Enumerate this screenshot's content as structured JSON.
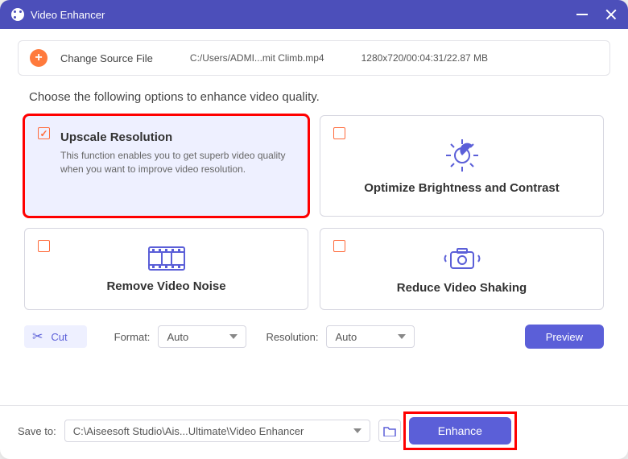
{
  "titlebar": {
    "title": "Video Enhancer"
  },
  "source": {
    "change_label": "Change Source File",
    "path": "C:/Users/ADMI...mit Climb.mp4",
    "info": "1280x720/00:04:31/22.87 MB"
  },
  "prompt": "Choose the following options to enhance video quality.",
  "options": {
    "upscale": {
      "title": "Upscale Resolution",
      "desc": "This function enables you to get superb video quality when you want to improve video resolution."
    },
    "brightness": {
      "title": "Optimize Brightness and Contrast"
    },
    "noise": {
      "title": "Remove Video Noise"
    },
    "shaking": {
      "title": "Reduce Video Shaking"
    }
  },
  "controls": {
    "cut": "Cut",
    "format_label": "Format:",
    "format_value": "Auto",
    "resolution_label": "Resolution:",
    "resolution_value": "Auto",
    "preview": "Preview"
  },
  "footer": {
    "save_label": "Save to:",
    "save_path": "C:\\Aiseesoft Studio\\Ais...Ultimate\\Video Enhancer",
    "enhance": "Enhance"
  }
}
